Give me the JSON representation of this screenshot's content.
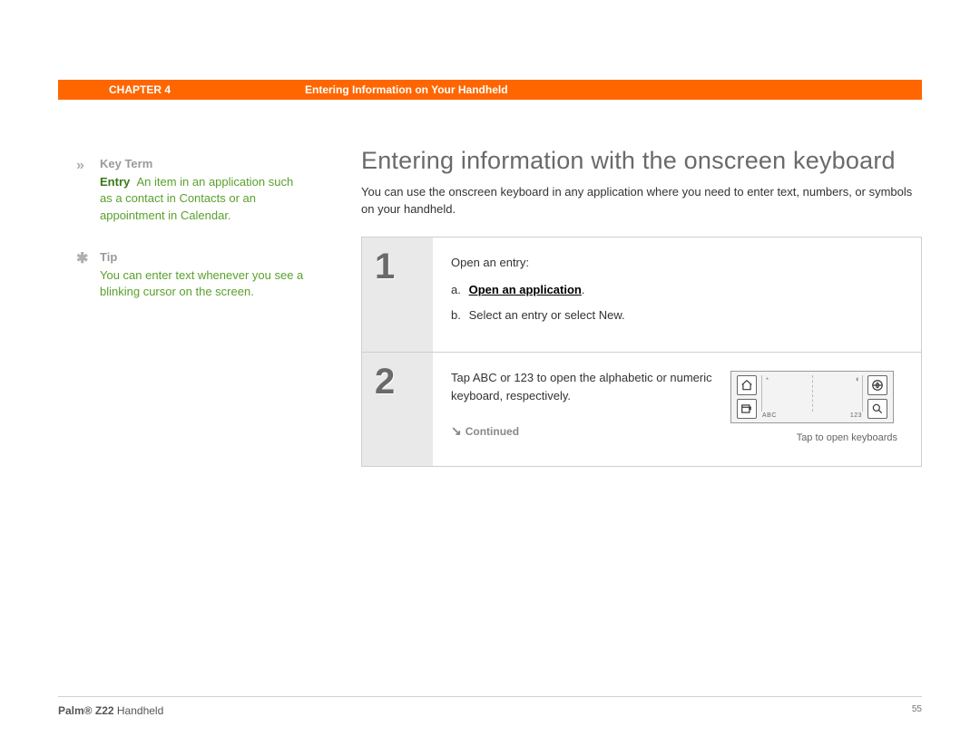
{
  "header": {
    "chapter": "CHAPTER 4",
    "title": "Entering Information on Your Handheld"
  },
  "sidebar": {
    "keyterm": {
      "icon": "»",
      "head": "Key Term",
      "term": "Entry",
      "definition": "An item in an application such as a contact in Contacts or an appointment in Calendar."
    },
    "tip": {
      "icon": "✱",
      "head": "Tip",
      "text": "You can enter text whenever you see a blinking cursor on the screen."
    }
  },
  "main": {
    "heading": "Entering information with the onscreen keyboard",
    "intro": "You can use the onscreen keyboard in any application where you need to enter text, numbers, or symbols on your handheld.",
    "steps": [
      {
        "num": "1",
        "lead": "Open an entry:",
        "sub_a_letter": "a.",
        "sub_a_text": "Open an application",
        "sub_a_dot": ".",
        "sub_b_letter": "b.",
        "sub_b_text": "Select an entry or select New."
      },
      {
        "num": "2",
        "text": "Tap ABC or 123 to open the alphabetic or numeric keyboard, respectively.",
        "continued_arrow": "↘",
        "continued": "Continued",
        "graffiti": {
          "abc": "ABC",
          "n123": "123",
          "caption": "Tap to open keyboards"
        }
      }
    ]
  },
  "footer": {
    "brand_bold": "Palm® Z22",
    "brand_rest": " Handheld",
    "page": "55"
  }
}
